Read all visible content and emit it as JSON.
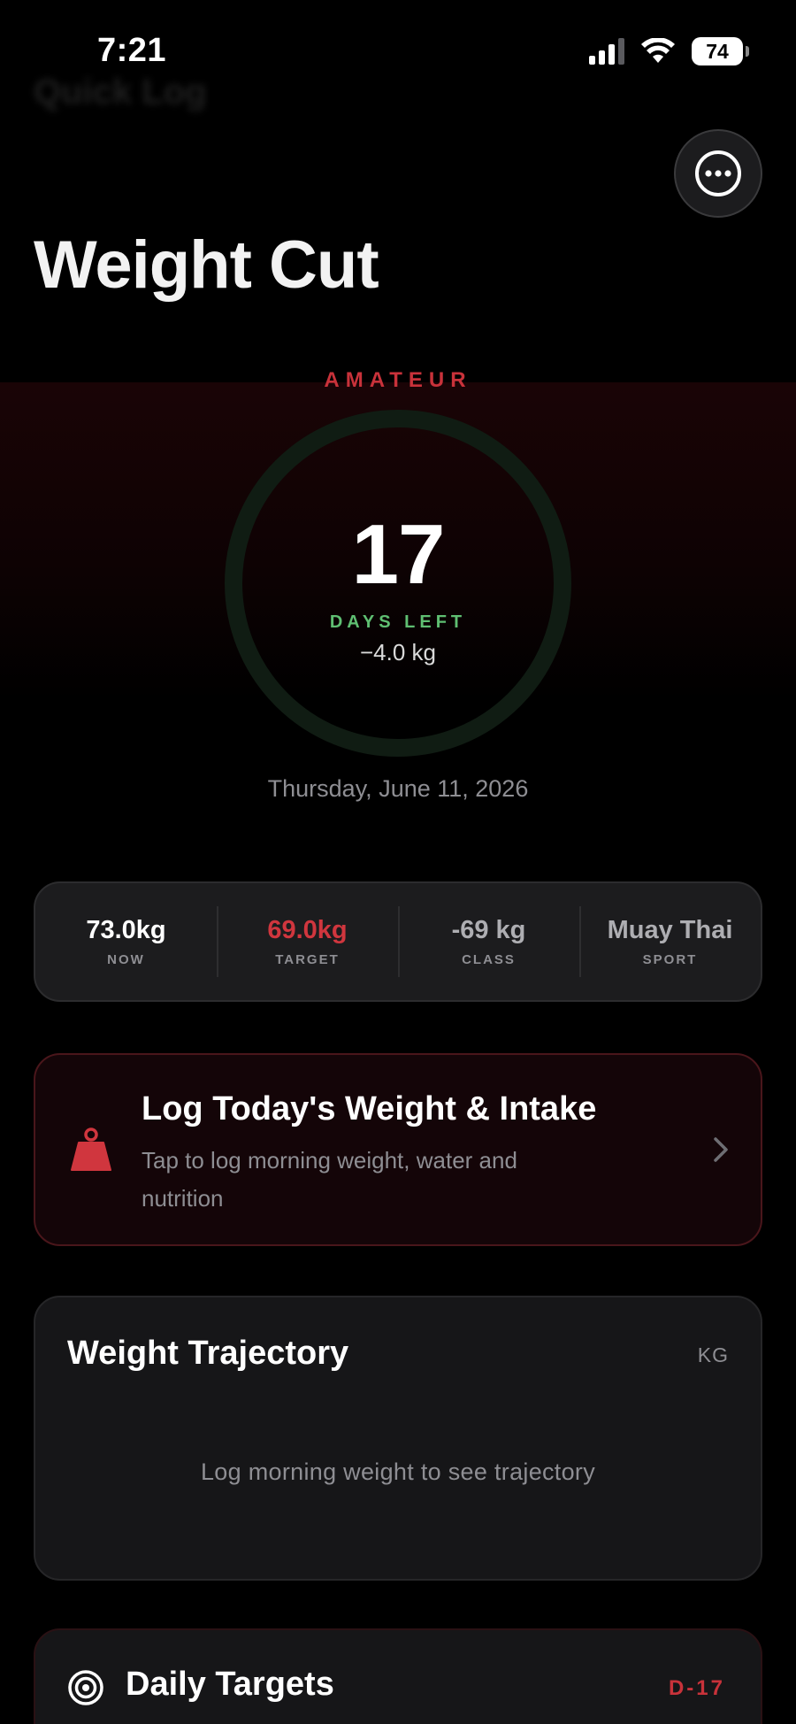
{
  "status_bar": {
    "time": "7:21",
    "battery": "74"
  },
  "background_header": "Quick Log",
  "page": {
    "title": "Weight Cut"
  },
  "hero": {
    "division": "AMATEUR",
    "days_left": "17",
    "days_label": "DAYS LEFT",
    "delta": "−4.0 kg",
    "event_date": "Thursday, June 11, 2026"
  },
  "stats": [
    {
      "value": "73.0kg",
      "label": "NOW",
      "color": "#ffffff"
    },
    {
      "value": "69.0kg",
      "label": "TARGET",
      "color": "#d0363e"
    },
    {
      "value": "-69 kg",
      "label": "CLASS",
      "color": "#aeaeb2"
    },
    {
      "value": "Muay Thai",
      "label": "SPORT",
      "color": "#aeaeb2"
    }
  ],
  "log_card": {
    "title": "Log Today's Weight & Intake",
    "subtitle": "Tap to log morning weight, water and nutrition",
    "icon": "weight-icon"
  },
  "trajectory": {
    "title": "Weight Trajectory",
    "unit": "KG",
    "empty_message": "Log morning weight to see trajectory"
  },
  "daily_targets": {
    "title": "Daily Targets",
    "countdown": "D-17",
    "icon": "target-icon"
  },
  "colors": {
    "accent_red": "#c8323a",
    "accent_green": "#5fbf72",
    "background": "#000000",
    "card": "#1c1c1e"
  }
}
